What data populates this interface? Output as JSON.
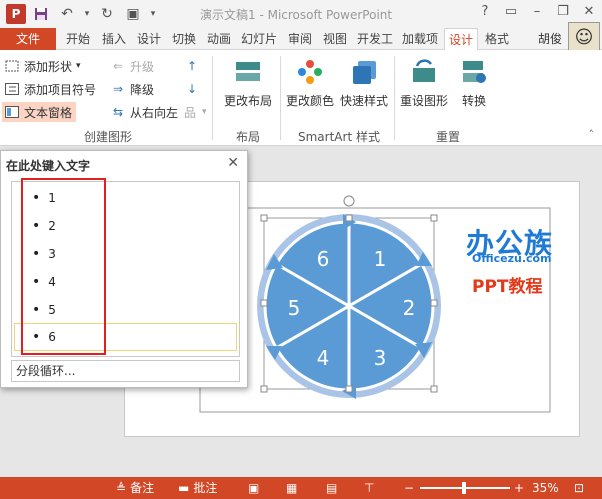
{
  "window": {
    "title": "演示文稿1 - Microsoft PowerPoint"
  },
  "tabs": [
    "文件",
    "开始",
    "插入",
    "设计",
    "切换",
    "动画",
    "幻灯片",
    "审阅",
    "视图",
    "开发工",
    "加载项",
    "设计",
    "格式"
  ],
  "user_name": "胡俊",
  "ribbon": {
    "add_shape": "添加形状",
    "add_bullet": "添加项目符号",
    "text_pane": "文本窗格",
    "promote": "升级",
    "demote": "降级",
    "right_to_left": "从右向左",
    "group_create": "创建图形",
    "change_layout": "更改布局",
    "group_layout": "布局",
    "change_colors": "更改颜色",
    "quick_styles": "快速样式",
    "group_smartart_styles": "SmartArt 样式",
    "reset_graphic": "重设图形",
    "convert": "转换",
    "group_reset": "重置"
  },
  "text_pane": {
    "title": "在此处键入文字",
    "items": [
      "1",
      "2",
      "3",
      "4",
      "5",
      "6"
    ],
    "footer": "分段循环..."
  },
  "diagram": {
    "labels": [
      "1",
      "2",
      "3",
      "4",
      "5",
      "6"
    ]
  },
  "watermark": {
    "main": "办公族",
    "sub": "Officezu.com",
    "ppt": "PPT教程"
  },
  "status": {
    "notes": "备注",
    "comments": "批注",
    "zoom": "35%"
  },
  "colors": {
    "accent": "#d24726",
    "shape": "#5b9bd5",
    "shape_light": "#a9c4e6"
  }
}
